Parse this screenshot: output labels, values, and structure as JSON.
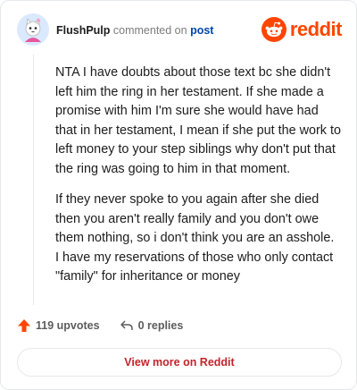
{
  "header": {
    "username": "FlushPulp",
    "verb": "commented on",
    "post_link": "post",
    "brand": "reddit",
    "brand_color": "#ff4500"
  },
  "comment": {
    "paragraphs": [
      "NTA I have doubts about those text bc she didn't left him the ring in her testament. If she made a promise with him I'm sure she would have had that in her testament, I mean if she put the work to left money to your step siblings why don't put that the ring was going to him in that moment.",
      "If they never spoke to you again after she died then you aren't really family and you don't owe them nothing, so i don't think you are an asshole. I have my reservations of those who only contact \"family\" for inheritance or money"
    ]
  },
  "footer": {
    "upvotes": "119 upvotes",
    "replies": "0 replies",
    "view_more": "View more on Reddit"
  },
  "icons": {
    "avatar": "cat-avatar-icon",
    "logo": "reddit-snoo-icon",
    "upvote": "upvote-arrow-icon",
    "reply": "reply-arrow-icon"
  }
}
